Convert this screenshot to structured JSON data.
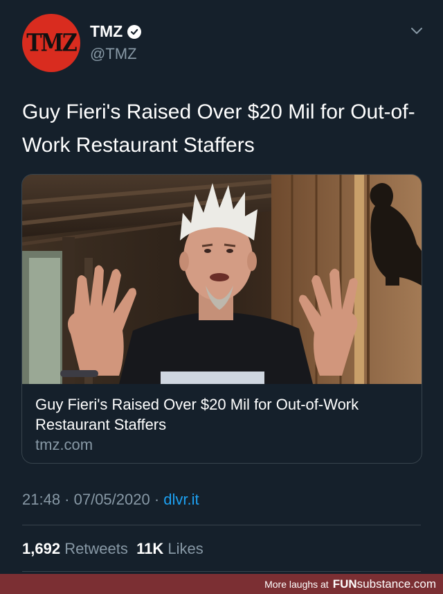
{
  "account": {
    "avatar_text": "TMZ",
    "display_name": "TMZ",
    "handle": "@TMZ"
  },
  "tweet": {
    "text": "Guy Fieri's Raised Over $20 Mil for Out-of-Work Restaurant Staffers",
    "timestamp": "21:48 · 07/05/2020 · ",
    "source": "dlvr.it"
  },
  "card": {
    "title": "Guy Fieri's Raised Over $20 Mil for Out-of-Work Restaurant Staffers",
    "domain": "tmz.com"
  },
  "stats": {
    "retweets_count": "1,692",
    "retweets_label": "Retweets",
    "likes_count": "11K",
    "likes_label": "Likes"
  },
  "footer": {
    "prefix": "More laughs at",
    "brand_bold": "FUN",
    "brand_rest": "substance.com"
  },
  "colors": {
    "background": "#15202b",
    "secondary_text": "#8899a6",
    "link": "#1da1f2",
    "avatar": "#d92c1f",
    "footer_bar": "#7b2f33"
  }
}
